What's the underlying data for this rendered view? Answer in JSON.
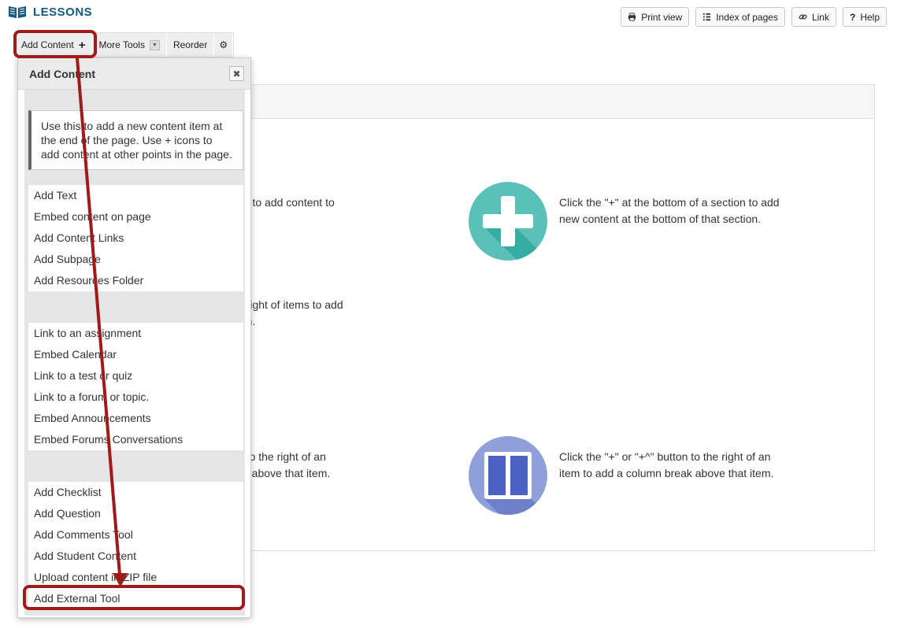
{
  "app": {
    "title": "LESSONS",
    "title_icon": "book-icon"
  },
  "header_buttons": [
    {
      "label": "Print view",
      "icon": "printer-icon"
    },
    {
      "label": "Index of pages",
      "icon": "list-icon"
    },
    {
      "label": "Link",
      "icon": "link-icon"
    },
    {
      "label": "Help",
      "icon": "question-icon"
    }
  ],
  "toolbar": {
    "add_content": "Add Content",
    "add_content_icon": "+",
    "more_tools": "More Tools",
    "reorder": "Reorder",
    "gear_icon": "⚙"
  },
  "popup": {
    "title": "Add Content",
    "close_icon": "✖",
    "info": "Use this to add a new content item at the end of the page. Use + icons to add content at other points in the page.",
    "groups": [
      [
        "Add Text",
        "Embed content on page",
        "Add Content Links",
        "Add Subpage",
        "Add Resources Folder"
      ],
      [
        "Link to an assignment",
        "Embed Calendar",
        "Link to a test or quiz",
        "Link to a forum or topic.",
        "Embed Announcements",
        "Embed Forums Conversations"
      ],
      [
        "Add Checklist",
        "Add Question",
        "Add Comments Tool",
        "Add Student Content",
        "Upload content in ZIP file",
        "Add External Tool"
      ]
    ]
  },
  "background_text": {
    "frag1": "ab to add content to",
    "frag2a": "e right of items to add",
    "frag2b": "em.",
    "frag3a": "n to the right of an",
    "frag3b": "ak above that item.",
    "plus_text_a": "Click the \"+\" at the bottom of a section to add",
    "plus_text_b": "new content at the bottom of that section.",
    "col_text_a": "Click the \"+\" or \"+^\" button to the right of an",
    "col_text_b": "item to add a column break above that item."
  },
  "colors": {
    "title": "#15597e",
    "highlight": "#a01a1a",
    "plus_circle": "#5bc0b8",
    "column_circle": "#8f9fd9"
  }
}
